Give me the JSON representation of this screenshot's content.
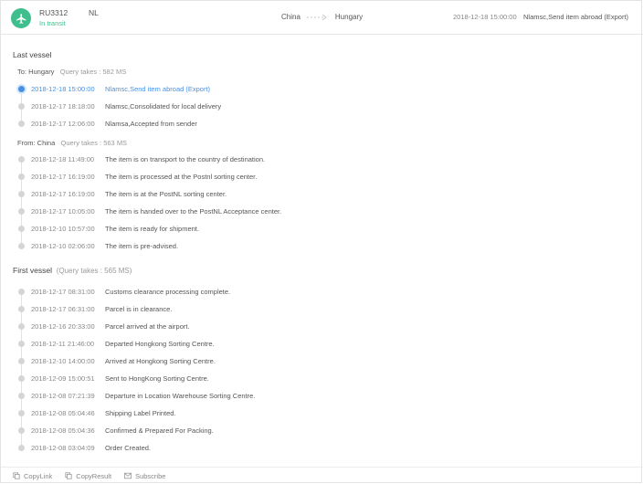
{
  "header": {
    "tracking_number": "RU3312",
    "destination_code": "NL",
    "status": "In transit",
    "origin": "China",
    "destination": "Hungary",
    "latest_time": "2018-12-18 15:00:00",
    "latest_event": "Nlamsc,Send item abroad (Export)",
    "accent_color": "#3fbf8d",
    "icon": "airplane-icon"
  },
  "last_vessel": {
    "title": "Last vessel",
    "groups": [
      {
        "label": "To: Hungary",
        "query": "Query takes : 582 MS",
        "events": [
          {
            "time": "2018-12-18 15:00:00",
            "desc": "Nlamsc,Send item abroad (Export)",
            "active": true
          },
          {
            "time": "2018-12-17 18:18:00",
            "desc": "Nlamsc,Consolidated for local delivery"
          },
          {
            "time": "2018-12-17 12:06:00",
            "desc": "Nlamsa,Accepted from sender"
          }
        ]
      },
      {
        "label": "From: China",
        "query": "Query takes : 563 MS",
        "events": [
          {
            "time": "2018-12-18 11:49:00",
            "desc": "The item is on transport to the country of destination."
          },
          {
            "time": "2018-12-17 16:19:00",
            "desc": "The item is processed at the Postnl sorting center."
          },
          {
            "time": "2018-12-17 16:19:00",
            "desc": "The item is at the PostNL sorting center."
          },
          {
            "time": "2018-12-17 10:05:00",
            "desc": "The item is handed over to the PostNL Acceptance center."
          },
          {
            "time": "2018-12-10 10:57:00",
            "desc": "The item is ready for shipment."
          },
          {
            "time": "2018-12-10 02:06:00",
            "desc": "The item is pre-advised."
          }
        ]
      }
    ]
  },
  "first_vessel": {
    "title": "First vessel",
    "query": "(Query takes : 565 MS)",
    "events": [
      {
        "time": "2018-12-17 08:31:00",
        "desc": "Customs clearance processing complete."
      },
      {
        "time": "2018-12-17 06:31:00",
        "desc": "Parcel is in clearance."
      },
      {
        "time": "2018-12-16 20:33:00",
        "desc": "Parcel arrived at the airport."
      },
      {
        "time": "2018-12-11 21:46:00",
        "desc": "Departed Hongkong Sorting Centre."
      },
      {
        "time": "2018-12-10 14:00:00",
        "desc": "Arrived at Hongkong Sorting Centre."
      },
      {
        "time": "2018-12-09 15:00:51",
        "desc": "Sent to HongKong Sorting Centre."
      },
      {
        "time": "2018-12-08 07:21:39",
        "desc": "Departure in Location Warehouse Sorting Centre."
      },
      {
        "time": "2018-12-08 05:04:46",
        "desc": "Shipping Label Printed."
      },
      {
        "time": "2018-12-08 05:04:36",
        "desc": "Confirmed & Prepared For Packing."
      },
      {
        "time": "2018-12-08 03:04:09",
        "desc": "Order Created."
      }
    ]
  },
  "footer": {
    "copy_link": "CopyLink",
    "copy_result": "CopyResult",
    "subscribe": "Subscribe"
  },
  "colors": {
    "active": "#4a90e2",
    "dot": "#d5d5d5"
  }
}
